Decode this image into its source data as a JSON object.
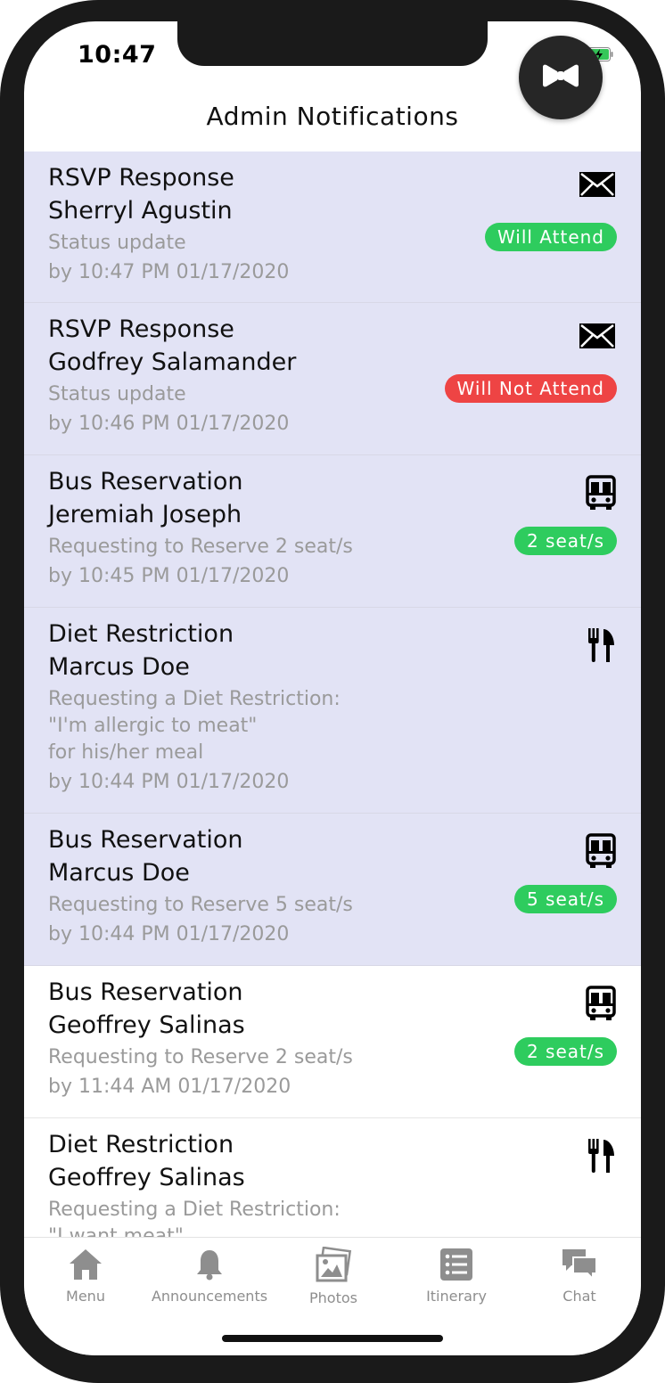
{
  "status_bar": {
    "time": "10:47",
    "signal": "....",
    "wifi_icon": "wifi-icon",
    "battery_icon": "battery-charging-icon"
  },
  "header": {
    "title": "Admin Notifications"
  },
  "fab": {
    "icon": "bow-tie-icon"
  },
  "colors": {
    "unread_bg": "#e2e3f5",
    "green": "#2ecc5e",
    "red": "#ee4444"
  },
  "notifications": [
    {
      "title": "RSVP Response",
      "name": "Sherryl Agustin",
      "desc": "Status update",
      "desc2": "",
      "desc3": "",
      "timestamp": "by 10:47 PM 01/17/2020",
      "icon": "envelope-icon",
      "badge": "Will Attend",
      "badge_color": "green",
      "unread": true
    },
    {
      "title": "RSVP Response",
      "name": "Godfrey Salamander",
      "desc": "Status update",
      "desc2": "",
      "desc3": "",
      "timestamp": "by 10:46 PM 01/17/2020",
      "icon": "envelope-icon",
      "badge": "Will Not Attend",
      "badge_color": "red",
      "unread": true
    },
    {
      "title": "Bus Reservation",
      "name": "Jeremiah Joseph",
      "desc": "Requesting to Reserve 2 seat/s",
      "desc2": "",
      "desc3": "",
      "timestamp": "by 10:45 PM 01/17/2020",
      "icon": "bus-icon",
      "badge": "2 seat/s",
      "badge_color": "green",
      "unread": true
    },
    {
      "title": "Diet Restriction",
      "name": "Marcus Doe",
      "desc": "Requesting a Diet Restriction:",
      "desc2": "\"I'm allergic to meat\"",
      "desc3": "for his/her meal",
      "timestamp": "by 10:44 PM 01/17/2020",
      "icon": "utensils-icon",
      "badge": "",
      "badge_color": "",
      "unread": true
    },
    {
      "title": "Bus Reservation",
      "name": "Marcus Doe",
      "desc": "Requesting to Reserve 5 seat/s",
      "desc2": "",
      "desc3": "",
      "timestamp": "by 10:44 PM 01/17/2020",
      "icon": "bus-icon",
      "badge": "5 seat/s",
      "badge_color": "green",
      "unread": true
    },
    {
      "title": "Bus Reservation",
      "name": "Geoffrey Salinas",
      "desc": "Requesting to Reserve 2 seat/s",
      "desc2": "",
      "desc3": "",
      "timestamp": "by 11:44 AM 01/17/2020",
      "icon": "bus-icon",
      "badge": "2 seat/s",
      "badge_color": "green",
      "unread": false
    },
    {
      "title": "Diet Restriction",
      "name": "Geoffrey Salinas",
      "desc": "Requesting a Diet Restriction:",
      "desc2": "\"I want meat\"",
      "desc3": "",
      "timestamp": "",
      "icon": "utensils-icon",
      "badge": "",
      "badge_color": "",
      "unread": false
    }
  ],
  "tabbar": {
    "items": [
      {
        "label": "Menu",
        "icon": "home-icon"
      },
      {
        "label": "Announcements",
        "icon": "bell-icon"
      },
      {
        "label": "Photos",
        "icon": "photos-icon"
      },
      {
        "label": "Itinerary",
        "icon": "list-icon"
      },
      {
        "label": "Chat",
        "icon": "chat-icon"
      }
    ]
  }
}
